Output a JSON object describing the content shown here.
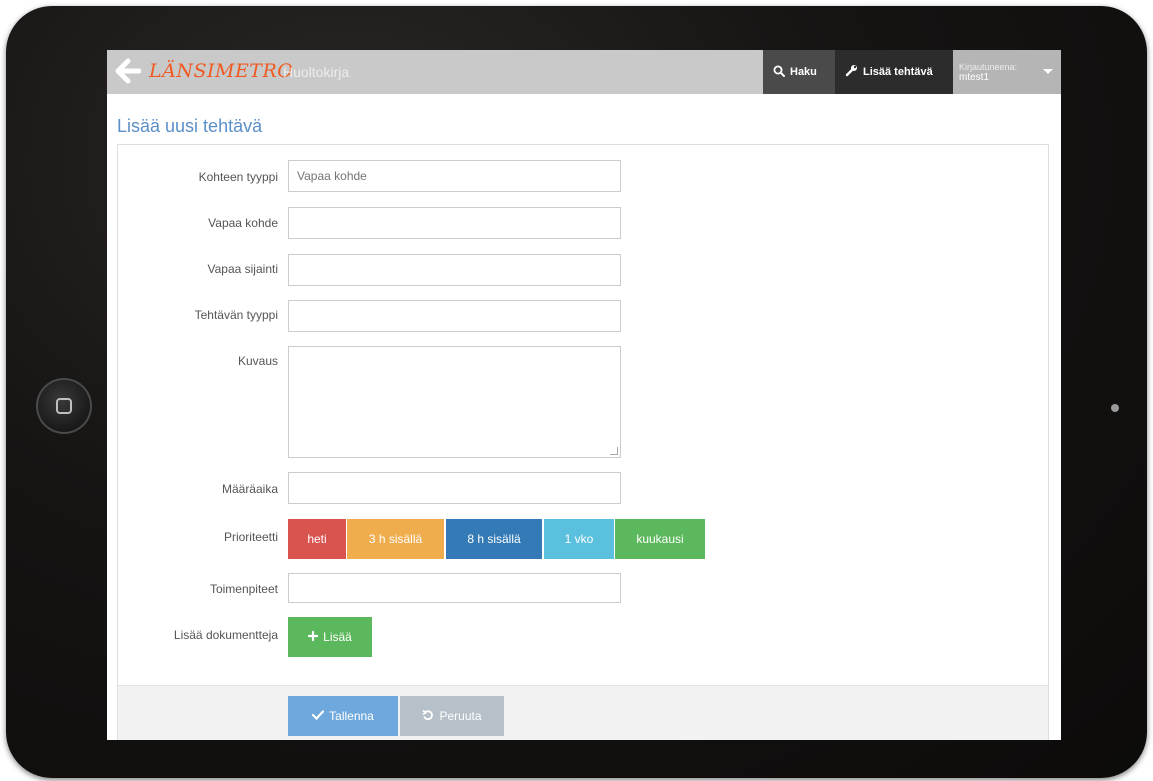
{
  "navbar": {
    "back_icon": "arrow-left-icon",
    "logo": "LÄNSIMETRO",
    "app_name": "Huoltokirja",
    "search_label": "Haku",
    "search_icon": "search-icon",
    "add_task_label": "Lisää tehtävä",
    "add_task_icon": "wrench-icon",
    "user_label": "Kirjautuneena:",
    "username": "mtest1",
    "user_menu_icon": "caret-down-icon"
  },
  "page": {
    "title": "Lisää uusi tehtävä"
  },
  "form": {
    "target_type": {
      "label": "Kohteen tyyppi",
      "value": "",
      "placeholder": "Vapaa kohde"
    },
    "free_target": {
      "label": "Vapaa kohde",
      "value": ""
    },
    "free_location": {
      "label": "Vapaa sijainti",
      "value": ""
    },
    "task_type": {
      "label": "Tehtävän tyyppi",
      "value": ""
    },
    "description": {
      "label": "Kuvaus",
      "value": ""
    },
    "deadline": {
      "label": "Määräaika",
      "value": ""
    },
    "priority": {
      "label": "Prioriteetti",
      "options": [
        "heti",
        "3 h sisällä",
        "8 h sisällä",
        "1 vko",
        "kuukausi"
      ],
      "colors": [
        "#d9534f",
        "#f0ad4e",
        "#337ab7",
        "#5bc0de",
        "#5cb85c"
      ]
    },
    "actions": {
      "label": "Toimenpiteet",
      "value": ""
    },
    "documents": {
      "label": "Lisää dokumentteja",
      "add_label": "Lisää",
      "add_icon": "plus-icon"
    }
  },
  "footer": {
    "save_label": "Tallenna",
    "save_icon": "check-icon",
    "cancel_label": "Peruuta",
    "cancel_icon": "undo-icon"
  },
  "colors": {
    "brand_orange": "#f05a22",
    "navbar": "#c9c9c9",
    "title_blue": "#5b8fc7"
  }
}
